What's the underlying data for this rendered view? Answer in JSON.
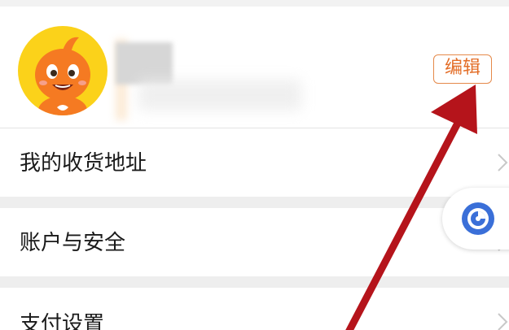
{
  "profile": {
    "edit_label": "编辑"
  },
  "menu": {
    "items": [
      {
        "label": "我的收货地址"
      },
      {
        "label": "账户与安全"
      },
      {
        "label": "支付设置"
      }
    ]
  },
  "colors": {
    "edit_accent": "#e36e28",
    "annotation_arrow": "#b5141b",
    "float_icon": "#3a6fd8",
    "avatar_bg": "#fbd21a",
    "mascot": "#f57a22"
  },
  "icons": {
    "avatar": "orange-mascot-avatar",
    "chevron": "chevron-right-icon",
    "float": "assistant-float-icon"
  }
}
